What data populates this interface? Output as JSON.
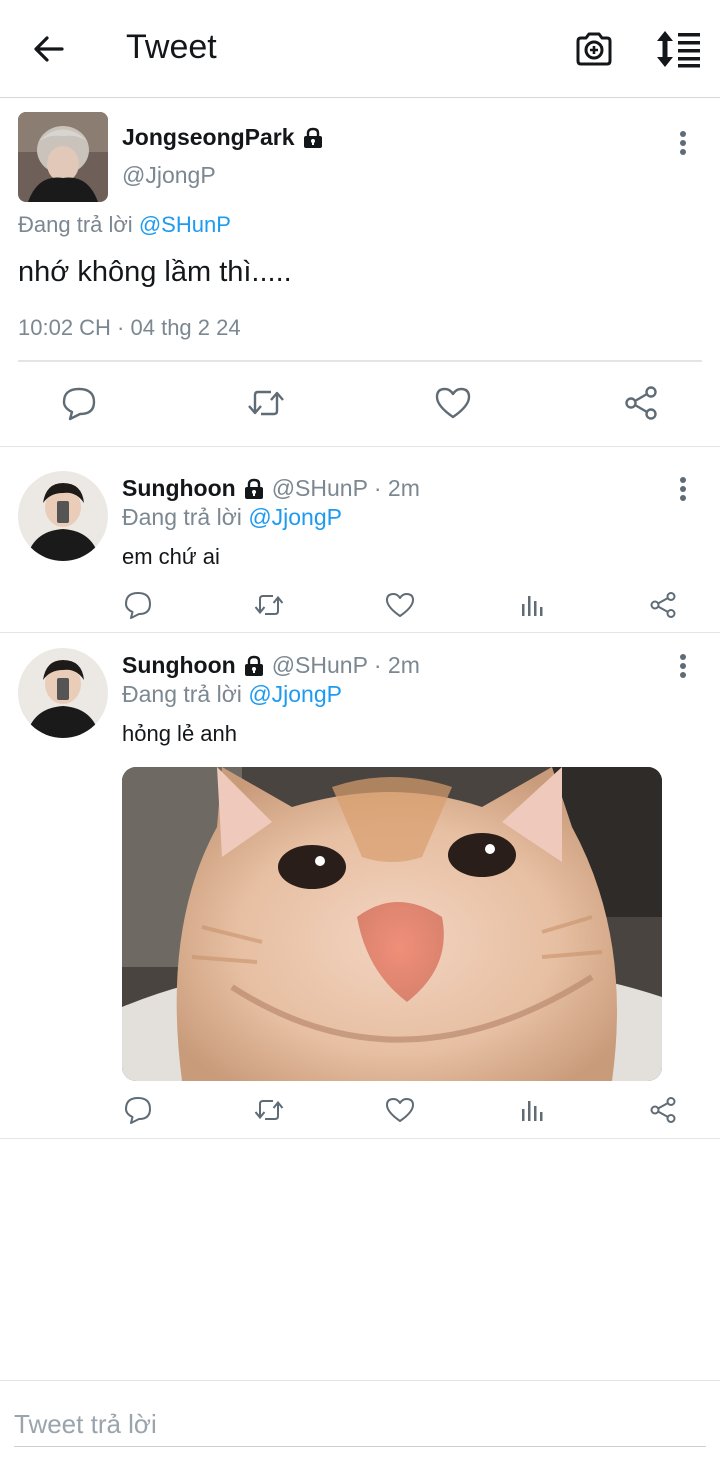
{
  "header": {
    "title": "Tweet",
    "back_icon": "arrow-left-icon",
    "camera_icon": "camera-plus-icon",
    "sort_icon": "sort-list-icon"
  },
  "main_tweet": {
    "name": "JongseongPark",
    "handle": "@JjongP",
    "reply_prefix": "Đang trả lời",
    "reply_to": "@SHunP",
    "text": "nhớ không lầm thì.....",
    "timestamp": "10:02 CH · 04 thg 2 24",
    "actions": [
      "reply-icon",
      "retweet-icon",
      "like-icon",
      "share-icon"
    ]
  },
  "replies": [
    {
      "name": "Sunghoon",
      "handle_time": "@SHunP · 2m",
      "reply_prefix": "Đang trả lời",
      "reply_to": "@JjongP",
      "text": "em chứ ai",
      "has_image": false
    },
    {
      "name": "Sunghoon",
      "handle_time": "@SHunP · 2m",
      "reply_prefix": "Đang trả lời",
      "reply_to": "@JjongP",
      "text": "hỏng lẻ anh",
      "has_image": true
    }
  ],
  "compose": {
    "placeholder": "Tweet trả lời"
  },
  "colors": {
    "accent": "#1d9bf0",
    "muted": "#7b8791",
    "divider": "#e1e5e8"
  }
}
